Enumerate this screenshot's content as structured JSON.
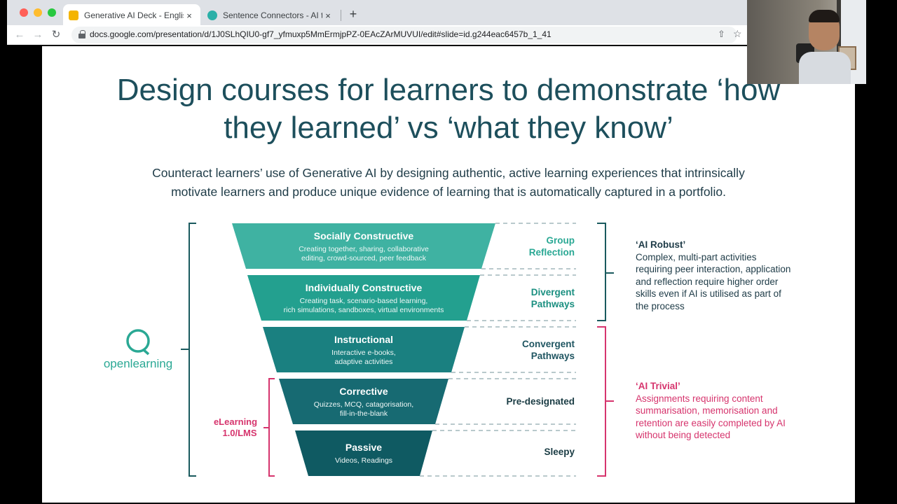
{
  "browser": {
    "tabs": [
      {
        "title": "Generative AI Deck - English A",
        "active": true,
        "favicon": "slides-icon"
      },
      {
        "title": "Sentence Connectors - AI testi",
        "active": false,
        "favicon": "ai-icon"
      }
    ],
    "url": "docs.google.com/presentation/d/1J0SLhQIU0-gf7_yfmuxp5MmErmjpPZ-0EAcZArMUVUI/edit#slide=id.g244eac6457b_1_41",
    "icons": {
      "close": "×",
      "new_tab": "+",
      "back": "←",
      "forward": "→",
      "reload": "↻",
      "share": "⇧",
      "star": "☆"
    }
  },
  "slide": {
    "title_line1": "Design courses for learners to demonstrate ‘how",
    "title_line2": "they learned’ vs ‘what they know’",
    "subtitle_line1": "Counteract learners’ use of Generative AI by designing authentic, active learning experiences that intrinsically",
    "subtitle_line2": "motivate learners and produce unique evidence of learning that is automatically captured in a portfolio.",
    "logo": "openlearning",
    "elearning_label_1": "eLearning",
    "elearning_label_2": "1.0/LMS",
    "levels": [
      {
        "title": "Socially Constructive",
        "desc1": "Creating together, sharing, collaborative",
        "desc2": "editing, crowd-sourced, peer feedback",
        "side1": "Group",
        "side2": "Reflection",
        "color": "#3fb2a2"
      },
      {
        "title": "Individually Constructive",
        "desc1": "Creating task, scenario-based learning,",
        "desc2": "rich simulations, sandboxes, virtual environments",
        "side1": "Divergent",
        "side2": "Pathways",
        "color": "#23a08f"
      },
      {
        "title": "Instructional",
        "desc1": "Interactive e-books,",
        "desc2": "adaptive activities",
        "side1": "Convergent",
        "side2": "Pathways",
        "color": "#1a8080"
      },
      {
        "title": "Corrective",
        "desc1": "Quizzes, MCQ, catagorisation,",
        "desc2": "fill-in-the-blank",
        "side1": "Pre-designated",
        "side2": "",
        "color": "#176a72"
      },
      {
        "title": "Passive",
        "desc1": "Videos, Readings",
        "desc2": "",
        "side1": "Sleepy",
        "side2": "",
        "color": "#0f5a62"
      }
    ],
    "robust": {
      "title": "‘AI Robust’",
      "text": "Complex, multi-part activities requiring peer interaction, application and reflection require higher order skills even if AI is utilised as part of the process"
    },
    "trivial": {
      "title": "‘AI Trivial’",
      "text": "Assignments requiring content summarisation, memorisation and retention are easily completed by AI without being detected"
    }
  },
  "colors": {
    "teal_dark": "#1d4f5c",
    "bracket_teal": "#1a5a5e",
    "pink": "#d6346d",
    "logo_green": "#2aa894"
  }
}
